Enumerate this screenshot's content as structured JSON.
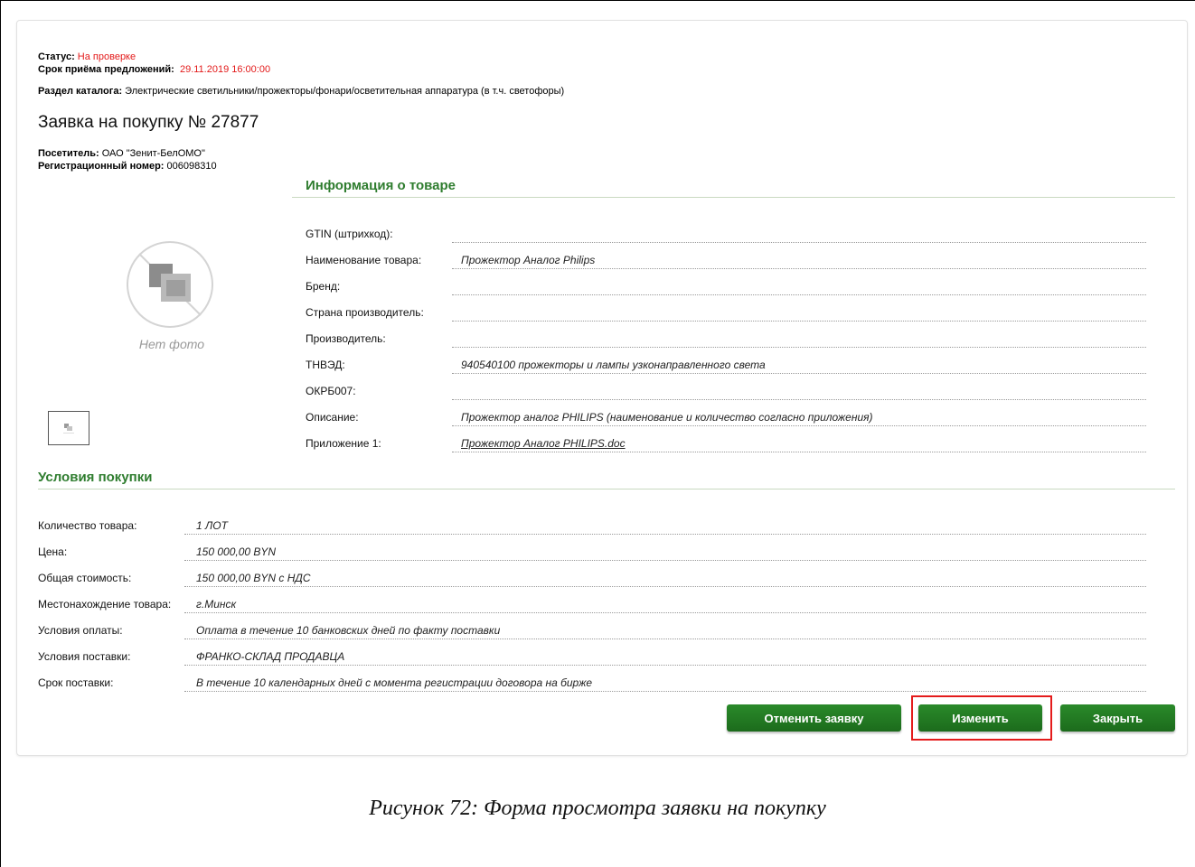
{
  "header": {
    "status_label": "Статус:",
    "status_value": "На проверке",
    "deadline_label": "Срок приёма предложений:",
    "deadline_value": "29.11.2019 16:00:00",
    "catalog_label": "Раздел каталога:",
    "catalog_value": "Электрические светильники/прожекторы/фонари/осветительная аппаратура (в т.ч. светофоры)",
    "title": "Заявка на покупку № 27877",
    "visitor_label": "Посетитель:",
    "visitor_value": "ОАО \"Зенит-БелОМО\"",
    "reg_label": "Регистрационный номер:",
    "reg_value": "006098310"
  },
  "photo": {
    "no_photo_text": "Нет фото",
    "icon": "no-photo-icon"
  },
  "product_info": {
    "title": "Информация о товаре",
    "rows": [
      {
        "label": "GTIN (штрихкод):",
        "value": ""
      },
      {
        "label": "Наименование товара:",
        "value": "Прожектор Аналог Philips"
      },
      {
        "label": "Бренд:",
        "value": ""
      },
      {
        "label": "Страна производитель:",
        "value": ""
      },
      {
        "label": "Производитель:",
        "value": ""
      },
      {
        "label": "ТНВЭД:",
        "value": "940540100 прожекторы и лампы узконаправленного света"
      },
      {
        "label": "ОКРБ007:",
        "value": ""
      },
      {
        "label": "Описание:",
        "value": "Прожектор аналог PHILIPS (наименование и количество согласно приложения)"
      },
      {
        "label": "Приложение 1:",
        "value": "Прожектор Аналог PHILIPS.doc"
      }
    ]
  },
  "purchase_terms": {
    "title": "Условия покупки",
    "rows": [
      {
        "label": "Количество товара:",
        "value": "1 ЛОТ"
      },
      {
        "label": "Цена:",
        "value": "150 000,00 BYN"
      },
      {
        "label": "Общая стоимость:",
        "value": "150 000,00 BYN с НДС"
      },
      {
        "label": "Местонахождение товара:",
        "value": "г.Минск"
      },
      {
        "label": "Условия оплаты:",
        "value": "Оплата в течение 10 банковских дней по факту поставки"
      },
      {
        "label": "Условия поставки:",
        "value": "ФРАНКО-СКЛАД ПРОДАВЦА"
      },
      {
        "label": "Срок поставки:",
        "value": "В течение 10 календарных дней с момента регистрации договора на бирже"
      }
    ]
  },
  "buttons": {
    "cancel": "Отменить заявку",
    "edit": "Изменить",
    "close": "Закрыть"
  },
  "caption": "Рисунок 72: Форма просмотра заявки на покупку",
  "colors": {
    "accent_green": "#2f7d2f",
    "button_green": "#1f7a1f",
    "status_red": "#e31a1a",
    "highlight_red": "#e41b1b"
  }
}
